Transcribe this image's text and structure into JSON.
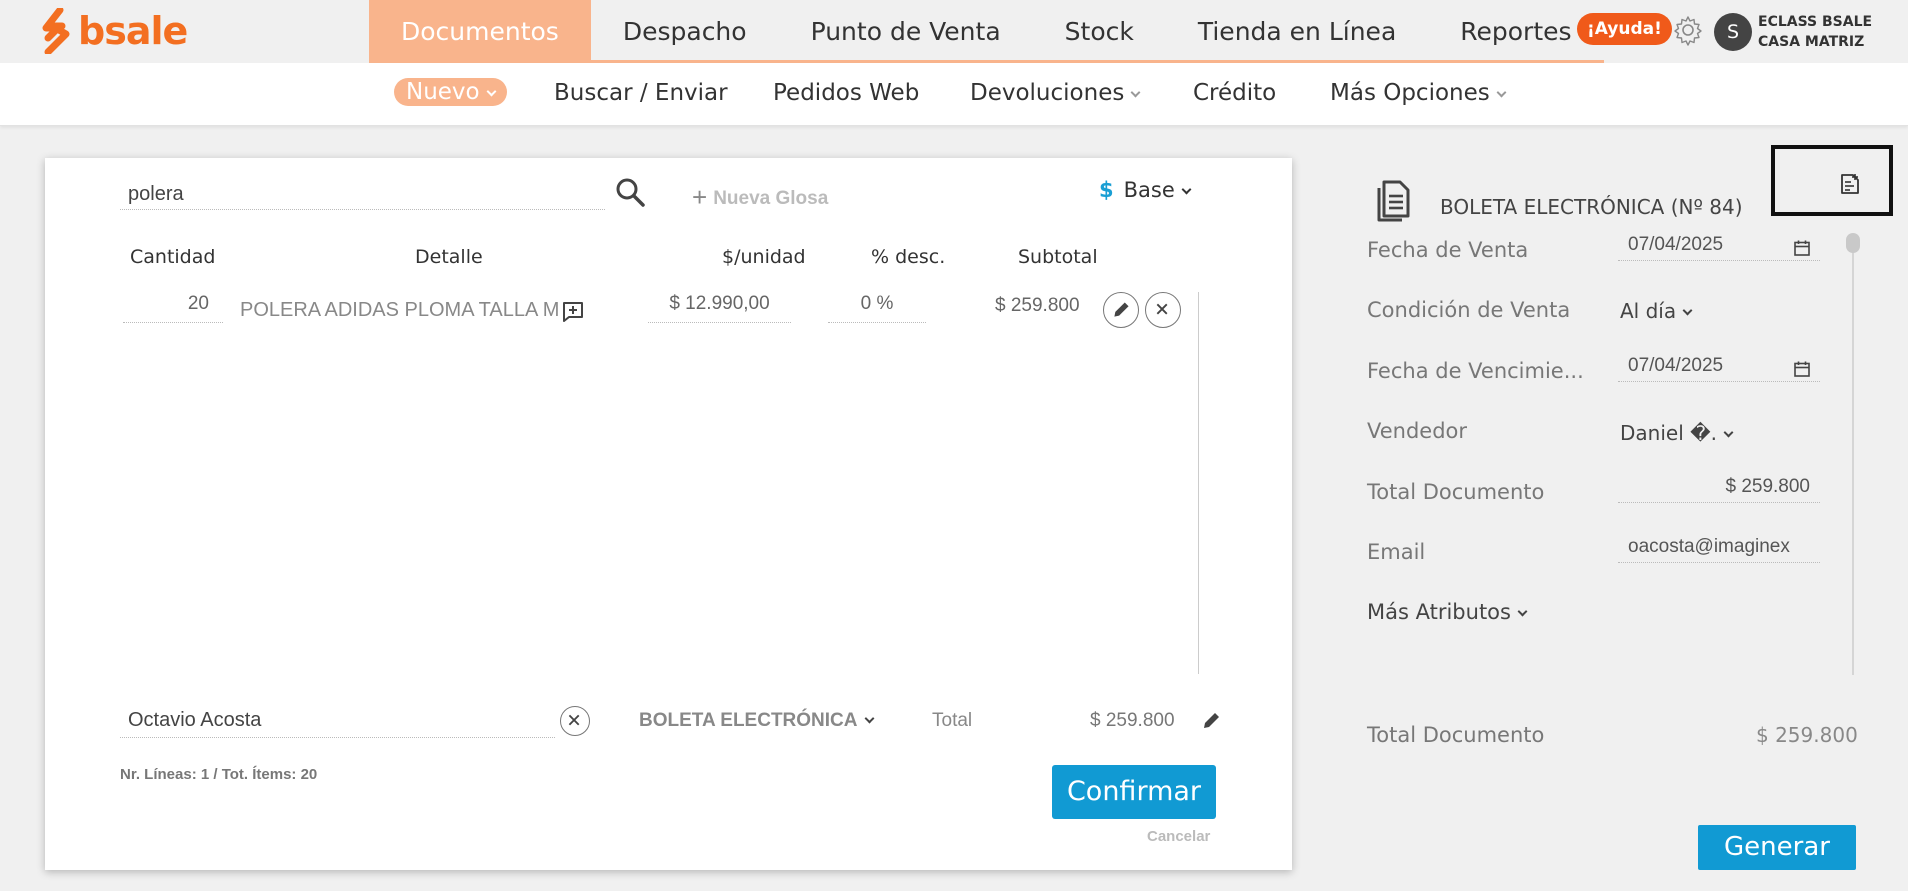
{
  "brand": {
    "name": "bsale",
    "color": "#f36f21"
  },
  "main_nav": [
    {
      "label": "Documentos",
      "active": true
    },
    {
      "label": "Despacho"
    },
    {
      "label": "Punto de Venta"
    },
    {
      "label": "Stock"
    },
    {
      "label": "Tienda en Línea"
    },
    {
      "label": "Reportes"
    }
  ],
  "header": {
    "help_label": "¡Ayuda!",
    "avatar_initial": "S",
    "company_line1": "ECLASS BSALE",
    "company_line2": "CASA MATRIZ",
    "settings_icon": "gear-icon"
  },
  "sub_nav": [
    {
      "label": "Nuevo",
      "active": true,
      "dropdown": true
    },
    {
      "label": "Buscar / Enviar"
    },
    {
      "label": "Pedidos Web"
    },
    {
      "label": "Devoluciones",
      "dropdown": true
    },
    {
      "label": "Crédito"
    },
    {
      "label": "Más Opciones",
      "dropdown": true
    }
  ],
  "document": {
    "search_value": "polera",
    "new_glosa_label": "Nueva Glosa",
    "price_list_symbol": "$",
    "price_list_label": "Base",
    "columns": [
      "Cantidad",
      "Detalle",
      "$/unidad",
      "% desc.",
      "Subtotal"
    ],
    "rows": [
      {
        "quantity": "20",
        "detail": "POLERA ADIDAS PLOMA TALLA M",
        "unit_price": "$ 12.990,00",
        "discount": "0 %",
        "subtotal": "$ 259.800"
      }
    ],
    "customer": "Octavio Acosta",
    "doc_type": "BOLETA ELECTRÓNICA",
    "total_label": "Total",
    "total_value": "$ 259.800",
    "lines_info": "Nr. Líneas: 1 / Tot. Ítems: 20",
    "confirm_label": "Confirmar",
    "cancel_label": "Cancelar"
  },
  "side_panel": {
    "title": "BOLETA ELECTRÓNICA (Nº 84)",
    "fields": {
      "sale_date_label": "Fecha de Venta",
      "sale_date_value": "07/04/2025",
      "condition_label": "Condición de Venta",
      "condition_value": "Al día",
      "due_date_label": "Fecha de Vencimie...",
      "due_date_value": "07/04/2025",
      "seller_label": "Vendedor",
      "seller_value": "Daniel �.",
      "total_doc_label": "Total Documento",
      "total_doc_value": "$ 259.800",
      "email_label": "Email",
      "email_value": "oacosta@imaginex"
    },
    "more_attributes_label": "Más Atributos",
    "summary_label": "Total Documento",
    "summary_value": "$ 259.800",
    "generate_label": "Generar"
  },
  "colors": {
    "accent_orange": "#f9b48c",
    "help_orange": "#f05a1a",
    "primary_blue": "#119ad3"
  }
}
